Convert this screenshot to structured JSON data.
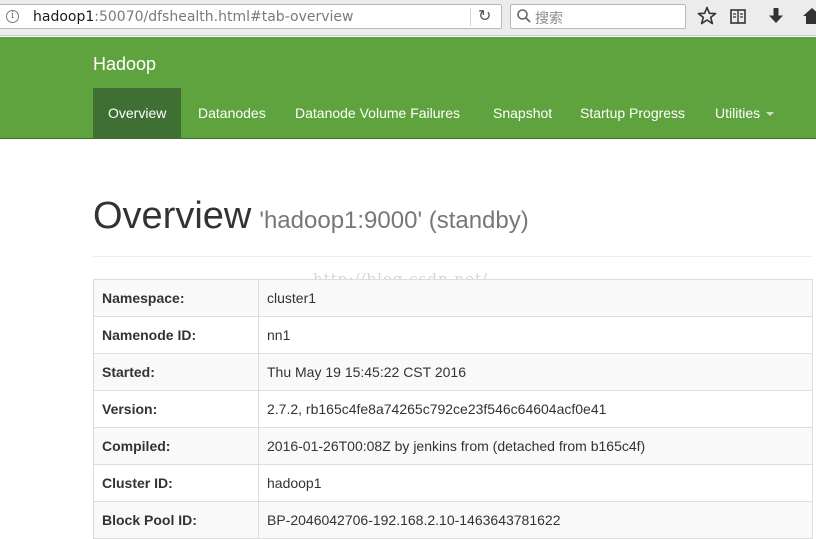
{
  "browser": {
    "url_host": "hadoop1",
    "url_rest": ":50070/dfshealth.html#tab-overview",
    "search_placeholder": "搜索",
    "icons": [
      "info-icon",
      "reload-icon",
      "search-icon",
      "bookmark-star-icon",
      "reading-list-icon",
      "download-icon",
      "home-icon"
    ]
  },
  "navbar": {
    "brand": "Hadoop",
    "tabs": [
      {
        "label": "Overview",
        "active": true
      },
      {
        "label": "Datanodes"
      },
      {
        "label": "Datanode Volume Failures"
      },
      {
        "label": "Snapshot"
      },
      {
        "label": "Startup Progress"
      },
      {
        "label": "Utilities"
      }
    ]
  },
  "header": {
    "title": "Overview",
    "subtitle": "'hadoop1:9000' (standby)"
  },
  "watermark": "http://blog.csdn.net/",
  "overview": {
    "rows": [
      {
        "key": "Namespace:",
        "value": "cluster1"
      },
      {
        "key": "Namenode ID:",
        "value": "nn1"
      },
      {
        "key": "Started:",
        "value": "Thu May 19 15:45:22 CST 2016"
      },
      {
        "key": "Version:",
        "value": "2.7.2, rb165c4fe8a74265c792ce23f546c64604acf0e41"
      },
      {
        "key": "Compiled:",
        "value": "2016-01-26T00:08Z by jenkins from (detached from b165c4f)"
      },
      {
        "key": "Cluster ID:",
        "value": "hadoop1"
      },
      {
        "key": "Block Pool ID:",
        "value": "BP-2046042706-192.168.2.10-1463643781622"
      }
    ]
  },
  "colors": {
    "navbar": "#5fa33e",
    "navbar_active": "#3f6f33"
  }
}
